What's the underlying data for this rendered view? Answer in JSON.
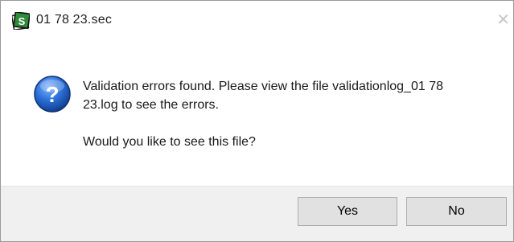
{
  "window": {
    "title": "01 78 23.sec",
    "close_label": "✕"
  },
  "icons": {
    "app": "app-logo-icon",
    "question": "question-icon"
  },
  "message": {
    "line1": "Validation errors found.  Please view the file validationlog_01 78",
    "line2": "23.log to see the errors.",
    "line3": "Would you like to see this file?"
  },
  "buttons": {
    "yes_label": "Yes",
    "no_label": "No"
  },
  "colors": {
    "app_icon_green": "#2e7d32",
    "question_blue": "#1f5fbf",
    "footer_bg": "#f0f0f0"
  }
}
